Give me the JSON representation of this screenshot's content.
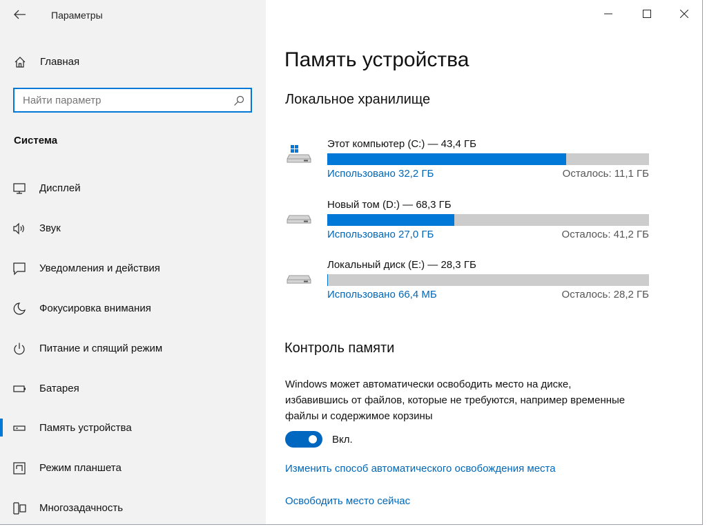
{
  "window": {
    "title": "Параметры",
    "accent": "#0078d7"
  },
  "sidebar": {
    "home_label": "Главная",
    "search": {
      "placeholder": "Найти параметр"
    },
    "section_title": "Система",
    "items": [
      {
        "label": "Дисплей",
        "icon": "monitor-icon"
      },
      {
        "label": "Звук",
        "icon": "speaker-icon"
      },
      {
        "label": "Уведомления и действия",
        "icon": "notification-icon"
      },
      {
        "label": "Фокусировка внимания",
        "icon": "moon-icon"
      },
      {
        "label": "Питание и спящий режим",
        "icon": "power-icon"
      },
      {
        "label": "Батарея",
        "icon": "battery-icon"
      },
      {
        "label": "Память устройства",
        "icon": "storage-icon",
        "selected": true
      },
      {
        "label": "Режим планшета",
        "icon": "tablet-icon"
      },
      {
        "label": "Многозадачность",
        "icon": "multitask-icon"
      }
    ]
  },
  "main": {
    "page_title": "Память устройства",
    "local_storage_title": "Локальное хранилище",
    "drives": [
      {
        "name": "Этот компьютер (C:) — 43,4 ГБ",
        "used": "Использовано 32,2 ГБ",
        "free": "Осталось: 11,1 ГБ",
        "used_fraction": 0.742,
        "system": true
      },
      {
        "name": "Новый том (D:) — 68,3 ГБ",
        "used": "Использовано 27,0 ГБ",
        "free": "Осталось: 41,2 ГБ",
        "used_fraction": 0.395,
        "system": false
      },
      {
        "name": "Локальный диск (E:) — 28,3 ГБ",
        "used": "Использовано 66,4 МБ",
        "free": "Осталось: 28,2 ГБ",
        "used_fraction": 0.002,
        "system": false
      }
    ],
    "storage_sense": {
      "title": "Контроль памяти",
      "description": "Windows может автоматически освободить место на диске, избавившись от файлов, которые не требуются, например временные файлы и содержимое корзины",
      "toggle_on": true,
      "toggle_label": "Вкл.",
      "link_change": "Изменить способ автоматического освобождения места",
      "link_free_now": "Освободить место сейчас"
    }
  }
}
